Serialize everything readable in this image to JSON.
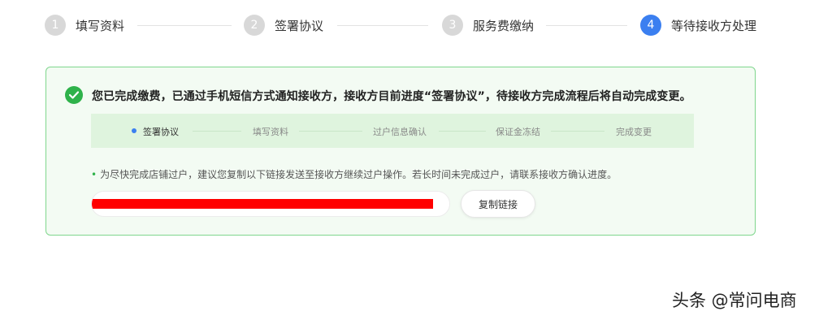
{
  "stepper": {
    "steps": [
      {
        "num": "1",
        "label": "填写资料"
      },
      {
        "num": "2",
        "label": "签署协议"
      },
      {
        "num": "3",
        "label": "服务费缴纳"
      },
      {
        "num": "4",
        "label": "等待接收方处理"
      }
    ],
    "active_index": 3
  },
  "notice": {
    "headline": "您已完成缴费，已通过手机短信方式通知接收方，接收方目前进度“签署协议”，待接收方完成流程后将自动完成变更。",
    "progress": [
      "签署协议",
      "填写资料",
      "过户信息确认",
      "保证金冻结",
      "完成变更"
    ],
    "current_progress": "签署协议",
    "bullet": "•",
    "note": "为尽快完成店铺过户，建议您复制以下链接发送至接收方继续过户操作。若长时间未完成过户，请联系接收方确认进度。",
    "copy_button": "复制链接"
  },
  "watermark": "头条 @常问电商",
  "colors": {
    "accent": "#3b7ff0",
    "success": "#2eb24a",
    "panel_bg": "#f3fbf3",
    "panel_border": "#7fd68d",
    "redaction": "#ff0000"
  }
}
